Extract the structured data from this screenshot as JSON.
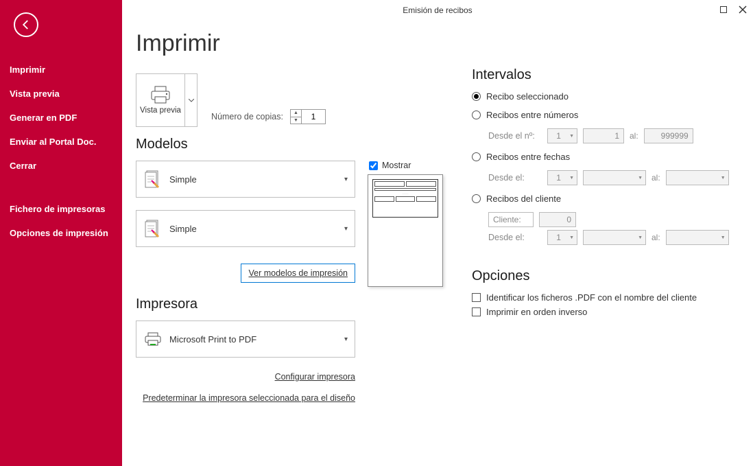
{
  "window": {
    "title": "Emisión de recibos"
  },
  "sidebar": {
    "items": [
      {
        "label": "Imprimir"
      },
      {
        "label": "Vista previa"
      },
      {
        "label": "Generar en PDF"
      },
      {
        "label": "Enviar al Portal Doc."
      },
      {
        "label": "Cerrar"
      },
      {
        "label": "Fichero de impresoras"
      },
      {
        "label": "Opciones de impresión"
      }
    ]
  },
  "page": {
    "heading": "Imprimir"
  },
  "preview": {
    "button_label": "Vista previa"
  },
  "copies": {
    "label": "Número de copias:",
    "value": "1"
  },
  "models": {
    "heading": "Modelos",
    "model1": "Simple",
    "model2": "Simple",
    "link_ver": "Ver modelos de impresión",
    "mostrar_label": "Mostrar",
    "mostrar_checked": true
  },
  "printer": {
    "heading": "Impresora",
    "selected": "Microsoft Print to PDF",
    "link_config": "Configurar impresora",
    "link_default": "Predeterminar la impresora seleccionada para el diseño"
  },
  "intervals": {
    "heading": "Intervalos",
    "opt_selected": "Recibo seleccionado",
    "opt_numbers": "Recibos entre números",
    "numbers": {
      "desde_label": "Desde el nº:",
      "desde_serie": "1",
      "desde_num": "1",
      "al_label": "al:",
      "hasta_num": "999999"
    },
    "opt_dates": "Recibos entre fechas",
    "dates": {
      "desde_label": "Desde el:",
      "desde_serie": "1",
      "desde_date": "",
      "al_label": "al:",
      "hasta_date": ""
    },
    "opt_client": "Recibos del cliente",
    "client": {
      "cliente_label": "Cliente:",
      "cliente_value": "0",
      "desde_label": "Desde el:",
      "desde_serie": "1",
      "desde_date": "",
      "al_label": "al:",
      "hasta_date": ""
    }
  },
  "options": {
    "heading": "Opciones",
    "opt1": "Identificar los ficheros .PDF con el nombre del cliente",
    "opt2": "Imprimir en orden inverso"
  }
}
